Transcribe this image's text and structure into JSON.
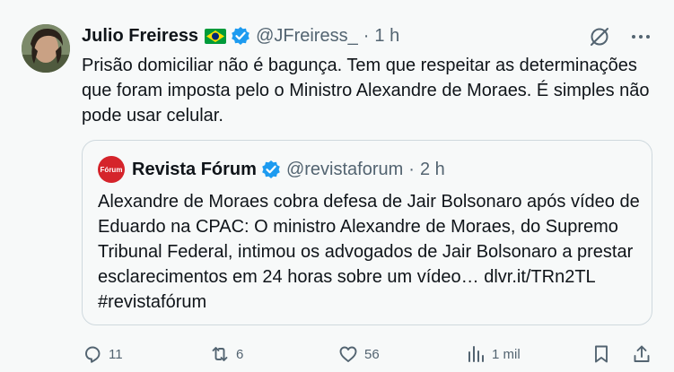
{
  "tweet": {
    "author_name": "Julio Freiress",
    "handle": "@JFreiress_",
    "separator": "·",
    "time": "1 h",
    "text": "Prisão domiciliar não é bagunça. Tem que respeitar as determinações que foram imposta pelo o Ministro Alexandre de Moraes. É simples não pode usar celular."
  },
  "quote": {
    "avatar_text": "Fórum",
    "author_name": "Revista Fórum",
    "handle": "@revistaforum",
    "separator": "·",
    "time": "2 h",
    "text": "Alexandre de Moraes cobra defesa de Jair Bolsonaro após vídeo de Eduardo na CPAC: O ministro Alexandre de Moraes, do Supremo Tribunal Federal, intimou os advogados de Jair Bolsonaro a prestar esclarecimentos em 24 horas sobre um vídeo… dlvr.it/TRn2TL #revistafórum"
  },
  "actions": {
    "replies": "11",
    "reposts": "6",
    "likes": "56",
    "views": "1 mil"
  },
  "colors": {
    "background": "#f7f9f9",
    "text": "#0f1419",
    "muted": "#536471",
    "verified": "#1d9bf0",
    "border": "#cfd9de"
  },
  "icons": [
    "brazil-flag-icon",
    "verified-badge-icon",
    "grok-icon",
    "more-icon",
    "reply-icon",
    "repost-icon",
    "like-icon",
    "views-icon",
    "bookmark-icon",
    "share-icon"
  ]
}
